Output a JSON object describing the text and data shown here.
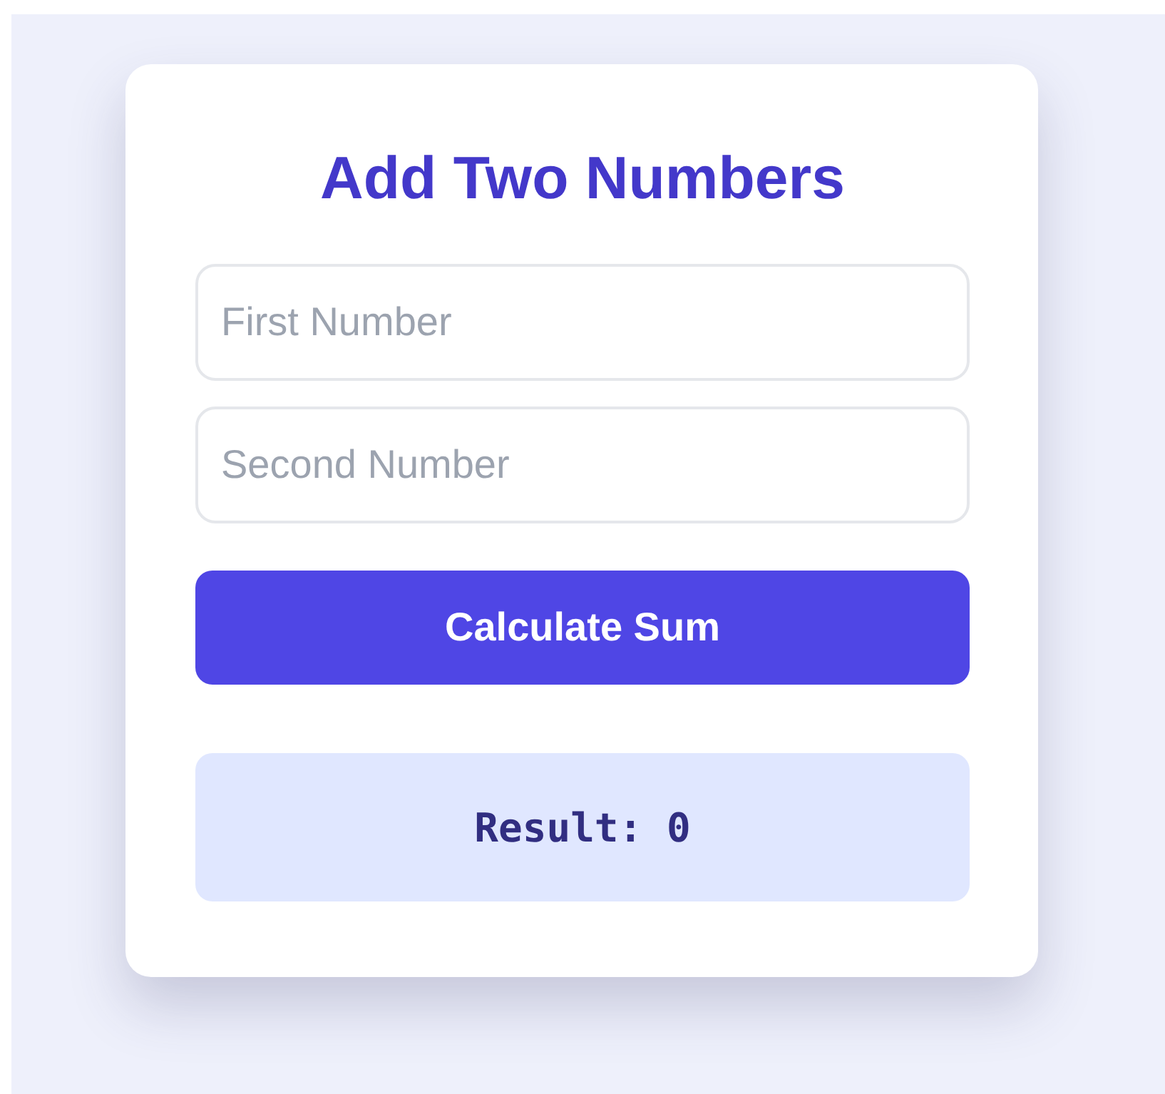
{
  "title": "Add Two Numbers",
  "fields": [
    {
      "placeholder": "First Number"
    },
    {
      "placeholder": "Second Number"
    }
  ],
  "button": {
    "label": "Calculate Sum"
  },
  "result": {
    "text": "Result: 0"
  }
}
